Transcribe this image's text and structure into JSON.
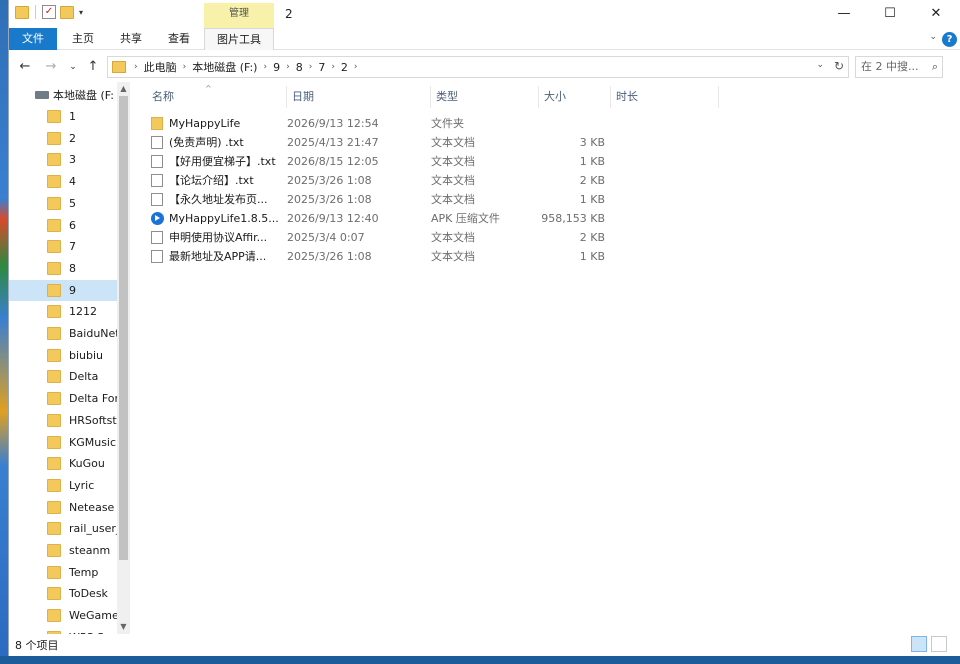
{
  "window": {
    "title": "2",
    "manage_tab": "管理",
    "controls": {
      "minimize": "—",
      "maximize": "☐",
      "close": "✕"
    }
  },
  "quick_access": {
    "check_glyph": "✓",
    "dropdown_glyph": "▾"
  },
  "ribbon": {
    "tabs": [
      "文件",
      "主页",
      "共享",
      "查看",
      "图片工具"
    ],
    "collapse_glyph": "⌄",
    "help_glyph": "?"
  },
  "address": {
    "back_glyph": "←",
    "forward_glyph": "→",
    "recent_glyph": "⌄",
    "up_glyph": "↑",
    "crumbs": [
      "此电脑",
      "本地磁盘 (F:)",
      "9",
      "8",
      "7",
      "2"
    ],
    "crumb_sep": "›",
    "dropdown_glyph": "⌄",
    "refresh_glyph": "↻",
    "search_placeholder": "在 2 中搜...",
    "search_glyph": "⌕"
  },
  "nav_pane": {
    "drive": "本地磁盘 (F:",
    "items": [
      "1",
      "2",
      "3",
      "4",
      "5",
      "6",
      "7",
      "8",
      "9",
      "1212",
      "BaiduNetd",
      "biubiu",
      "Delta",
      "Delta Forc",
      "HRSoftsto",
      "KGMusic",
      "KuGou",
      "Lyric",
      "Netease",
      "rail_user_c",
      "steanm",
      "Temp",
      "ToDesk",
      "WeGameA",
      "WPS S..."
    ],
    "selected": "9",
    "scroll_up": "▲",
    "scroll_down": "▼"
  },
  "columns": {
    "name": "名称",
    "date": "日期",
    "type": "类型",
    "size": "大小",
    "length": "时长",
    "sort_glyph": "^"
  },
  "files": [
    {
      "icon": "folder-icon",
      "name": "MyHappyLife",
      "date": "2026/9/13 12:54",
      "type": "文件夹",
      "size": ""
    },
    {
      "icon": "text-file-icon",
      "name": "(免责声明) .txt",
      "date": "2025/4/13 21:47",
      "type": "文本文档",
      "size": "3 KB"
    },
    {
      "icon": "text-file-icon",
      "name": "【好用便宜梯子】.txt",
      "date": "2026/8/15 12:05",
      "type": "文本文档",
      "size": "1 KB"
    },
    {
      "icon": "text-file-icon",
      "name": "【论坛介绍】.txt",
      "date": "2025/3/26 1:08",
      "type": "文本文档",
      "size": "2 KB"
    },
    {
      "icon": "text-file-icon",
      "name": "【永久地址发布页...",
      "date": "2025/3/26 1:08",
      "type": "文本文档",
      "size": "1 KB"
    },
    {
      "icon": "apk-icon",
      "name": "MyHappyLife1.8.5...",
      "date": "2026/9/13 12:40",
      "type": "APK 压缩文件",
      "size": "958,153 KB"
    },
    {
      "icon": "text-file-icon",
      "name": "申明使用协议Affir...",
      "date": "2025/3/4 0:07",
      "type": "文本文档",
      "size": "2 KB"
    },
    {
      "icon": "text-file-icon",
      "name": "最新地址及APP请...",
      "date": "2025/3/26 1:08",
      "type": "文本文档",
      "size": "1 KB"
    }
  ],
  "status": {
    "item_count": "8 个项目"
  }
}
